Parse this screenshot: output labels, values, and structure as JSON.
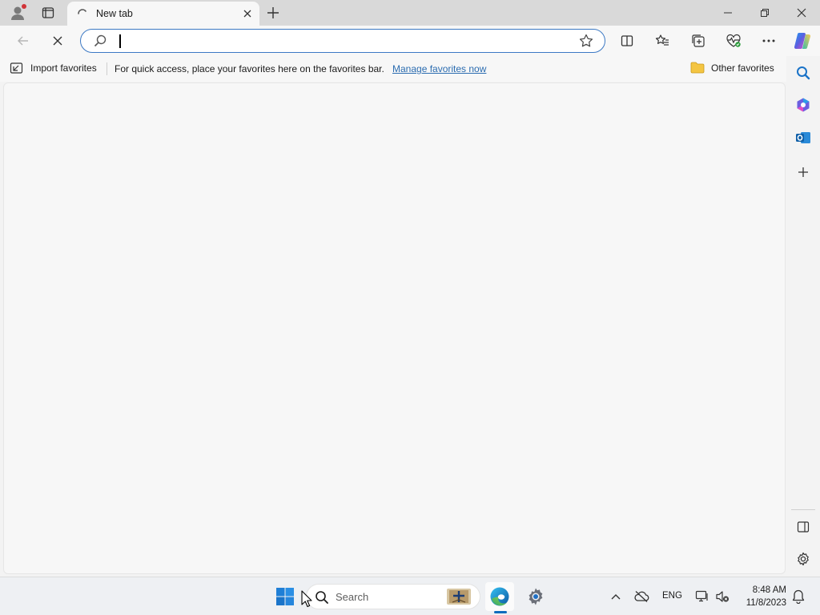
{
  "browser": {
    "tab": {
      "title": "New tab"
    },
    "omnibox": {
      "value": "",
      "placeholder": ""
    },
    "favorites_bar": {
      "import_label": "Import favorites",
      "message": "For quick access, place your favorites here on the favorites bar.",
      "manage_link": "Manage favorites now",
      "other_label": "Other favorites"
    },
    "icons": {
      "profile": "profile-icon",
      "workspaces": "tab-actions-icon",
      "tab_loading": "loading-spinner-icon",
      "tab_close": "close-icon",
      "new_tab": "plus-icon",
      "minimize": "minimize-icon",
      "restore": "restore-icon",
      "close": "close-icon",
      "back": "back-arrow-icon",
      "stop": "stop-icon",
      "search": "search-icon",
      "favorite": "star-icon",
      "split_screen": "split-screen-icon",
      "favorites": "favorites-icon",
      "collections": "collections-icon",
      "performance": "heartbeat-icon",
      "more": "more-icon",
      "copilot": "copilot-icon"
    }
  },
  "sidebar": {
    "items": [
      "search-icon",
      "microsoft365-icon",
      "outlook-icon",
      "add-icon"
    ],
    "bottom": [
      "hide-sidebar-icon",
      "settings-icon"
    ]
  },
  "taskbar": {
    "search_label": "Search",
    "language": "ENG",
    "time": "8:48 AM",
    "date": "11/8/2023"
  },
  "colors": {
    "accent": "#0f6cbd",
    "link": "#2b6cb0",
    "omnibox_border": "#3c79c4",
    "profile_badge": "#d13438"
  }
}
